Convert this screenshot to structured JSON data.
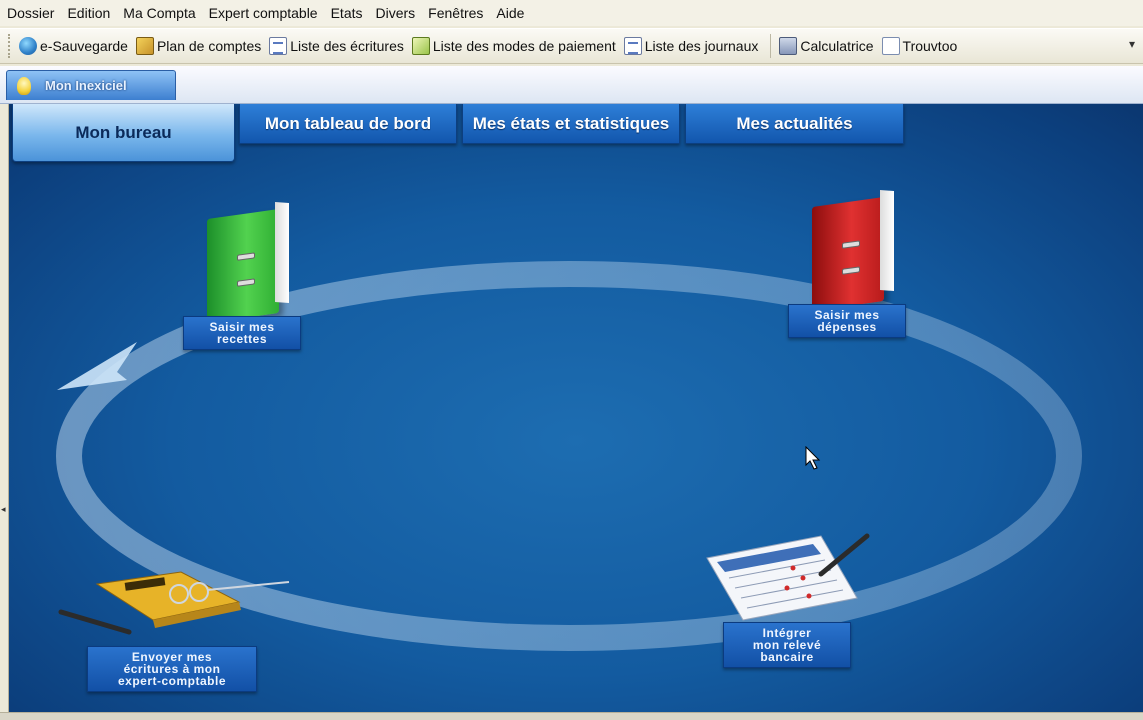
{
  "menu": [
    "Dossier",
    "Edition",
    "Ma Compta",
    "Expert comptable",
    "Etats",
    "Divers",
    "Fenêtres",
    "Aide"
  ],
  "toolbar": {
    "buttons": [
      {
        "label": "e-Sauvegarde",
        "icon": "globe-icon"
      },
      {
        "label": "Plan de comptes",
        "icon": "book-icon"
      },
      {
        "label": "Liste des écritures",
        "icon": "list-icon"
      },
      {
        "label": "Liste des modes de paiement",
        "icon": "payment-icon"
      },
      {
        "label": "Liste des journaux",
        "icon": "journal-icon"
      },
      {
        "label": "Calculatrice",
        "icon": "calculator-icon"
      },
      {
        "label": "Trouvtoo",
        "icon": "search-document-icon"
      }
    ],
    "more": "▾"
  },
  "doc_tab": {
    "label": "Mon Inexiciel"
  },
  "nav_tabs": [
    {
      "label": "Mon bureau",
      "active": true
    },
    {
      "label": "Mon tableau de bord",
      "active": false
    },
    {
      "label": "Mes états et statistiques",
      "active": false
    },
    {
      "label": "Mes actualités",
      "active": false
    }
  ],
  "actions": {
    "recettes": "Saisir mes\nrecettes",
    "depenses": "Saisir mes\ndépenses",
    "releve": "Intégrer\nmon relevé\nbancaire",
    "envoyer": "Envoyer mes\nécritures à mon\nexpert-comptable"
  },
  "colors": {
    "stage_bg": "#135ba0",
    "tab_blue": "#1256ad",
    "active_tab": "#7ab7ec",
    "binder_green": "#52d24f",
    "binder_red": "#e03131"
  }
}
